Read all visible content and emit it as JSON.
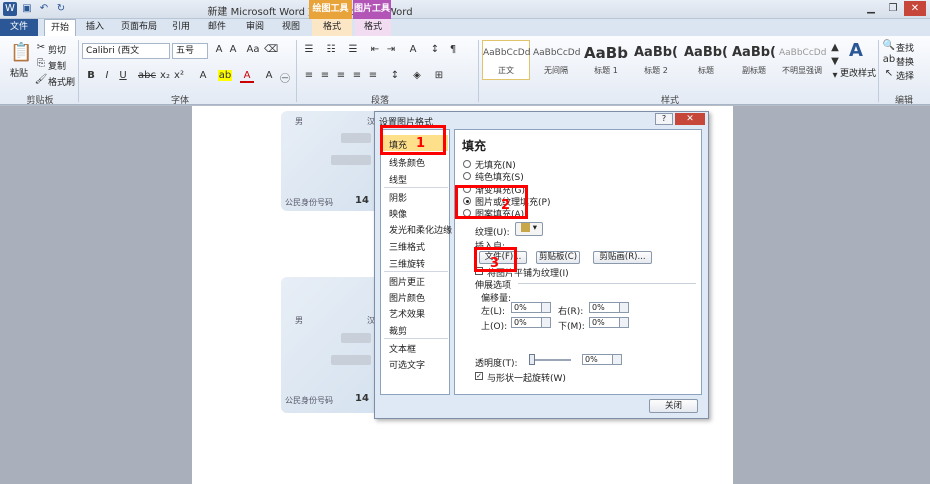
{
  "titlebar": {
    "title": "新建 Microsoft Word 文档 - Microsoft Word",
    "ctx_drawing": "绘图工具",
    "ctx_picture": "图片工具"
  },
  "tabs": [
    "文件",
    "开始",
    "插入",
    "页面布局",
    "引用",
    "邮件",
    "审阅",
    "视图",
    "格式",
    "格式"
  ],
  "ribbon": {
    "clipboard": {
      "paste": "粘贴",
      "cut": "剪切",
      "copy": "复制",
      "painter": "格式刷",
      "group": "剪贴板"
    },
    "font": {
      "name": "Calibri (西文",
      "size": "五号",
      "group": "字体"
    },
    "paragraph": {
      "group": "段落"
    },
    "styles": {
      "items": [
        {
          "preview": "AaBbCcDd",
          "name": "正文"
        },
        {
          "preview": "AaBbCcDd",
          "name": "无间隔"
        },
        {
          "preview": "AaBb",
          "name": "标题 1"
        },
        {
          "preview": "AaBb(",
          "name": "标题 2"
        },
        {
          "preview": "AaBb(",
          "name": "标题"
        },
        {
          "preview": "AaBb(",
          "name": "副标题"
        },
        {
          "preview": "AaBbCcDd",
          "name": "不明显强调"
        }
      ],
      "change": "更改样式",
      "group": "样式"
    },
    "editing": {
      "find": "查找",
      "replace": "替换",
      "select": "选择",
      "group": "编辑"
    }
  },
  "card": {
    "gender": "男",
    "nation": "汉",
    "id_label": "公民身份号码",
    "id_prefix": "14"
  },
  "dialog": {
    "title": "设置图片格式",
    "help": "?",
    "categories": [
      "填充",
      "线条颜色",
      "线型",
      "阴影",
      "映像",
      "发光和柔化边缘",
      "三维格式",
      "三维旋转",
      "图片更正",
      "图片颜色",
      "艺术效果",
      "裁剪",
      "文本框",
      "可选文字"
    ],
    "panel_title": "填充",
    "fill_options": [
      "无填充(N)",
      "纯色填充(S)",
      "渐变填充(G)",
      "图片或纹理填充(P)",
      "图案填充(A)"
    ],
    "texture_label": "纹理(U):",
    "insert_from": "插入自:",
    "btn_file": "文件(F)...",
    "btn_clipboard": "剪贴板(C)",
    "btn_clipart": "剪贴画(R)...",
    "tile": "将图片平铺为纹理(I)",
    "stretch": "伸展选项",
    "offsets": "偏移量:",
    "left": "左(L):",
    "right": "右(R):",
    "top": "上(O):",
    "bottom": "下(M):",
    "offset_left": "0%",
    "offset_right": "0%",
    "offset_top": "0%",
    "offset_bottom": "0%",
    "transparency": "透明度(T):",
    "transparency_value": "0%",
    "rotate": "与形状一起旋转(W)",
    "close": "关闭"
  },
  "annotations": [
    "1",
    "2",
    "3"
  ]
}
